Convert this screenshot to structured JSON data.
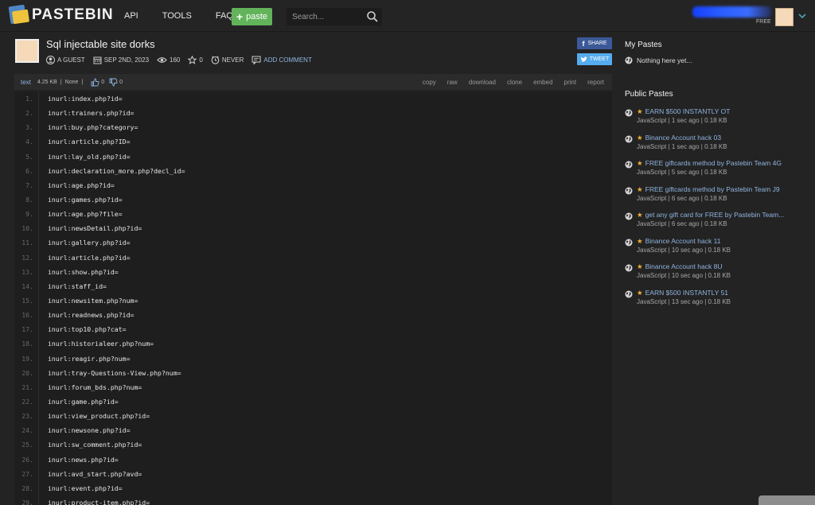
{
  "header": {
    "logo_text": "PASTEBIN",
    "nav": [
      "API",
      "TOOLS",
      "FAQ"
    ],
    "paste_label": "paste",
    "search_placeholder": "Search...",
    "account_label": "FREE"
  },
  "paste": {
    "title": "Sql injectable site dorks",
    "author": "A GUEST",
    "date": "SEP 2ND, 2023",
    "views": "160",
    "stars": "0",
    "expires": "NEVER",
    "add_comment": "ADD COMMENT",
    "share_label": "SHARE",
    "tweet_label": "TWEET"
  },
  "codebar": {
    "syntax": "text",
    "size": "4.25 KB",
    "category": "None",
    "likes": "0",
    "dislikes": "0",
    "actions": [
      "copy",
      "raw",
      "download",
      "clone",
      "embed",
      "print",
      "report"
    ]
  },
  "code_lines": [
    "inurl:index.php?id=",
    "inurl:trainers.php?id=",
    "inurl:buy.php?category=",
    "inurl:article.php?ID=",
    "inurl:lay_old.php?id=",
    "inurl:declaration_more.php?decl_id=",
    "inurl:age.php?id=",
    "inurl:games.php?id=",
    "inurl:age.php?file=",
    "inurl:newsDetail.php?id=",
    "inurl:gallery.php?id=",
    "inurl:article.php?id=",
    "inurl:show.php?id=",
    "inurl:staff_id=",
    "inurl:newsitem.php?num=",
    "inurl:readnews.php?id=",
    "inurl:top10.php?cat=",
    "inurl:historialeer.php?num=",
    "inurl:reagir.php?num=",
    "inurl:tray-Questions-View.php?num=",
    "inurl:forum_bds.php?num=",
    "inurl:game.php?id=",
    "inurl:view_product.php?id=",
    "inurl:newsone.php?id=",
    "inurl:sw_comment.php?id=",
    "inurl:news.php?id=",
    "inurl:avd_start.php?avd=",
    "inurl:event.php?id=",
    "inurl:product-item.php?id="
  ],
  "sidebar": {
    "my_pastes_title": "My Pastes",
    "my_pastes_empty": "Nothing here yet...",
    "public_pastes_title": "Public Pastes",
    "public_pastes": [
      {
        "title": "EARN $500 INSTANTLY OT",
        "meta": "JavaScript | 1 sec ago | 0.18 KB"
      },
      {
        "title": "Binance Account hack 03",
        "meta": "JavaScript | 1 sec ago | 0.18 KB"
      },
      {
        "title": "FREE giftcards method by Pastebin Team 4G",
        "meta": "JavaScript | 5 sec ago | 0.18 KB"
      },
      {
        "title": "FREE giftcards method by Pastebin Team J9",
        "meta": "JavaScript | 6 sec ago | 0.18 KB"
      },
      {
        "title": "get any gift card for FREE by Pastebin Team...",
        "meta": "JavaScript | 6 sec ago | 0.18 KB"
      },
      {
        "title": "Binance Account hack 11",
        "meta": "JavaScript | 10 sec ago | 0.18 KB"
      },
      {
        "title": "Binance Account hack 8U",
        "meta": "JavaScript | 10 sec ago | 0.18 KB"
      },
      {
        "title": "EARN $500 INSTANTLY 51",
        "meta": "JavaScript | 13 sec ago | 0.18 KB"
      }
    ]
  },
  "colors": {
    "background": "#232323",
    "link": "#8fb4e0",
    "paste_button": "#62b35a",
    "share": "#3b5998",
    "tweet": "#55acee",
    "star": "#f2b233"
  },
  "icons": [
    "logo-icon",
    "search-icon",
    "chevron-down-icon",
    "user-icon",
    "calendar-icon",
    "eye-icon",
    "star-icon",
    "clock-icon",
    "comment-icon",
    "thumbs-up-icon",
    "thumbs-down-icon",
    "globe-icon",
    "facebook-icon",
    "twitter-icon"
  ]
}
